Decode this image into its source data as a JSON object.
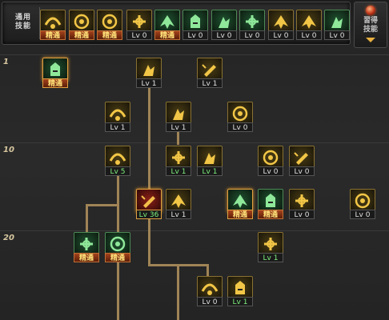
{
  "topbar": {
    "label": "通用\n技能"
  },
  "learn_panel": {
    "label": "習得\n技能"
  },
  "tiers": [
    "1",
    "10",
    "20"
  ],
  "common_skills": [
    {
      "icon": "sit-icon",
      "theme": "gold",
      "badge": "精通"
    },
    {
      "icon": "wing-swirl-icon",
      "theme": "gold",
      "badge": "精通"
    },
    {
      "icon": "runner-icon",
      "theme": "gold",
      "badge": "精通"
    },
    {
      "icon": "wings-icon",
      "theme": "gold",
      "badge": "Lv 0"
    },
    {
      "icon": "target-icon",
      "theme": "green",
      "badge": "精通"
    },
    {
      "icon": "crosshair-icon",
      "theme": "green",
      "badge": "Lv 0"
    },
    {
      "icon": "figure-icon",
      "theme": "green",
      "badge": "Lv 0"
    },
    {
      "icon": "kneeling-figure-icon",
      "theme": "green",
      "badge": "Lv 0"
    },
    {
      "icon": "shield-ring-icon",
      "theme": "gold",
      "badge": "Lv 0"
    },
    {
      "icon": "strongman-icon",
      "theme": "gold",
      "badge": "Lv 0"
    },
    {
      "icon": "cross-figure-icon",
      "theme": "green",
      "badge": "Lv 0"
    }
  ],
  "tree_skills": [
    {
      "icon": "reload-icon",
      "theme": "green",
      "badge": "精通",
      "badge_style": "master",
      "selected": true
    },
    {
      "icon": "arrow-up-icon",
      "theme": "gold",
      "badge": "Lv 1",
      "badge_style": "normal"
    },
    {
      "icon": "gun-strike-icon",
      "theme": "gold",
      "badge": "Lv 1",
      "badge_style": "normal"
    },
    {
      "icon": "burst-icon",
      "theme": "gold",
      "badge": "Lv 1",
      "badge_style": "normal"
    },
    {
      "icon": "speed-lines-icon",
      "theme": "gold",
      "badge": "Lv 1",
      "badge_style": "normal"
    },
    {
      "icon": "cannon-icon",
      "theme": "gold",
      "badge": "Lv 0",
      "badge_style": "normal"
    },
    {
      "icon": "slash-icon",
      "theme": "gold",
      "badge": "Lv 5",
      "badge_style": "green"
    },
    {
      "icon": "flame-icon",
      "theme": "gold",
      "badge": "Lv 1",
      "badge_style": "green"
    },
    {
      "icon": "sword-icon",
      "theme": "gold",
      "badge": "Lv 1",
      "badge_style": "green"
    },
    {
      "icon": "upload-box-icon",
      "theme": "gold",
      "badge": "Lv 0",
      "badge_style": "normal"
    },
    {
      "icon": "eagle-icon",
      "theme": "gold",
      "badge": "Lv 0",
      "badge_style": "normal"
    },
    {
      "icon": "soldier-icon",
      "theme": "red",
      "badge": "Lv 36",
      "badge_style": "green",
      "selected": true
    },
    {
      "icon": "hammer-icon",
      "theme": "gold",
      "badge": "Lv 1",
      "badge_style": "normal"
    },
    {
      "icon": "gunner-icon",
      "theme": "green",
      "badge": "精通",
      "badge_style": "master",
      "selected": true
    },
    {
      "icon": "sprint-icon",
      "theme": "green",
      "badge": "精通",
      "badge_style": "master"
    },
    {
      "icon": "explosion-icon",
      "theme": "gold",
      "badge": "Lv 0",
      "badge_style": "normal"
    },
    {
      "icon": "grenade-icon",
      "theme": "gold",
      "badge": "Lv 0",
      "badge_style": "normal"
    },
    {
      "icon": "bullet-icon",
      "theme": "green",
      "badge": "精通",
      "badge_style": "master"
    },
    {
      "icon": "run-boost-icon",
      "theme": "green",
      "badge": "精通",
      "badge_style": "master"
    },
    {
      "icon": "shield-icon",
      "theme": "gold",
      "badge": "Lv 1",
      "badge_style": "green"
    },
    {
      "icon": "blade-icon",
      "theme": "gold",
      "badge": "Lv 0",
      "badge_style": "normal"
    },
    {
      "icon": "sniper-icon",
      "theme": "gold",
      "badge": "Lv 1",
      "badge_style": "green"
    }
  ]
}
